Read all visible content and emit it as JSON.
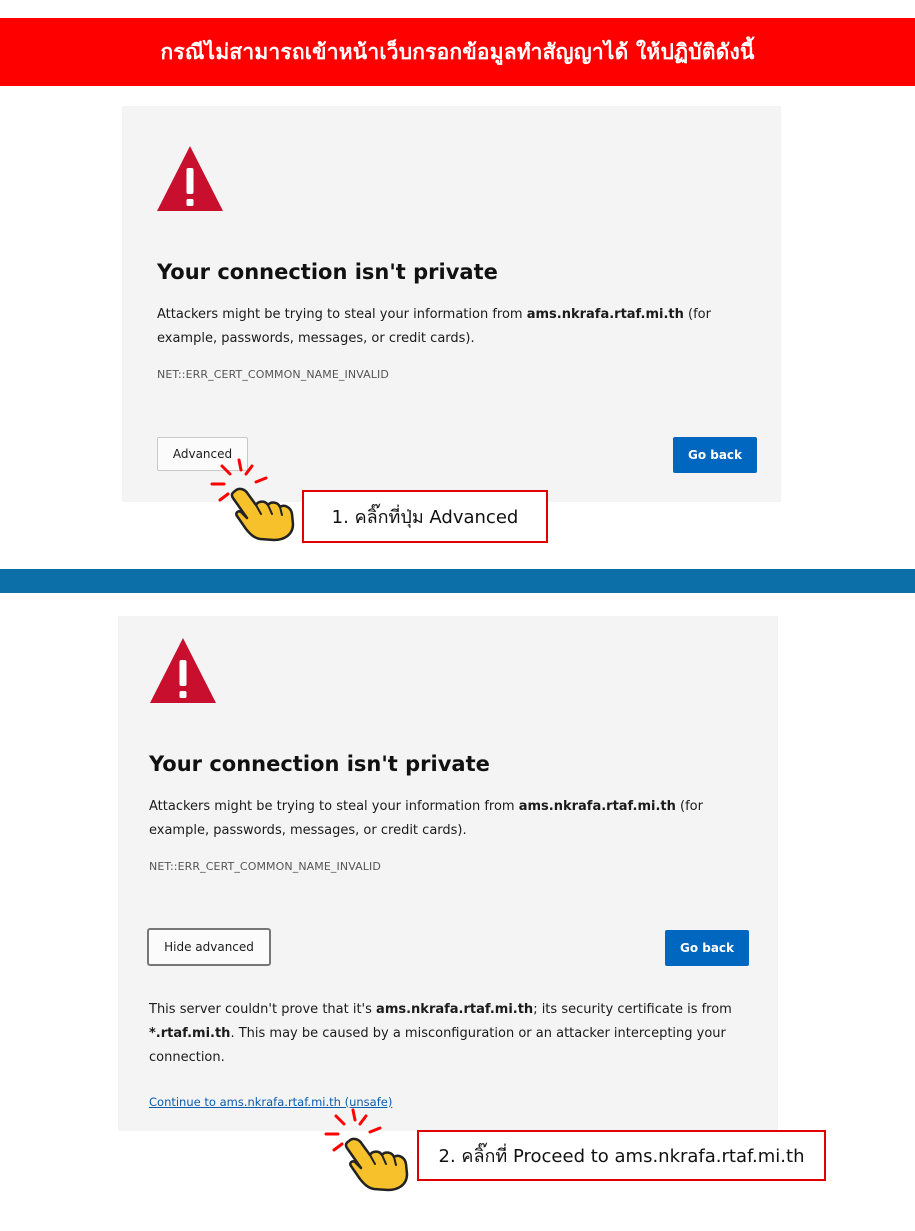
{
  "banner": {
    "text": "กรณีไม่สามารถเข้าหน้าเว็บกรอกข้อมูลทำสัญญาได้ ให้ปฏิบัติดังนี้"
  },
  "colors": {
    "banner": "#ff0000",
    "divider": "#0c6fa8",
    "primary_button": "#0067c0",
    "warning_icon": "#c8102e",
    "callout_border": "#e00000"
  },
  "step1": {
    "icon": "warning-triangle-icon",
    "title": "Your connection isn't private",
    "desc_before": "Attackers might be trying to steal your information from ",
    "desc_host": "ams.nkrafa.rtaf.mi.th",
    "desc_after": " (for example, passwords, messages, or credit cards).",
    "error_code": "NET::ERR_CERT_COMMON_NAME_INVALID",
    "advanced_label": "Advanced",
    "go_back_label": "Go back",
    "callout": "1. คลิ๊กที่ปุ่ม Advanced",
    "pointer_icon": "pointing-hand-icon"
  },
  "step2": {
    "icon": "warning-triangle-icon",
    "title": "Your connection isn't private",
    "desc_before": "Attackers might be trying to steal your information from ",
    "desc_host": "ams.nkrafa.rtaf.mi.th",
    "desc_after": " (for example, passwords, messages, or credit cards).",
    "error_code": "NET::ERR_CERT_COMMON_NAME_INVALID",
    "hide_advanced_label": "Hide advanced",
    "go_back_label": "Go back",
    "details_1": "This server couldn't prove that it's ",
    "details_host": "ams.nkrafa.rtaf.mi.th",
    "details_2": "; its security certificate is from ",
    "details_cert": "*.rtaf.mi.th",
    "details_3": ". This may be caused by a misconfiguration or an attacker intercepting your connection.",
    "proceed_link": "Continue to ams.nkrafa.rtaf.mi.th (unsafe)",
    "callout": "2. คลิ๊กที่ Proceed to ams.nkrafa.rtaf.mi.th",
    "pointer_icon": "pointing-hand-icon"
  }
}
